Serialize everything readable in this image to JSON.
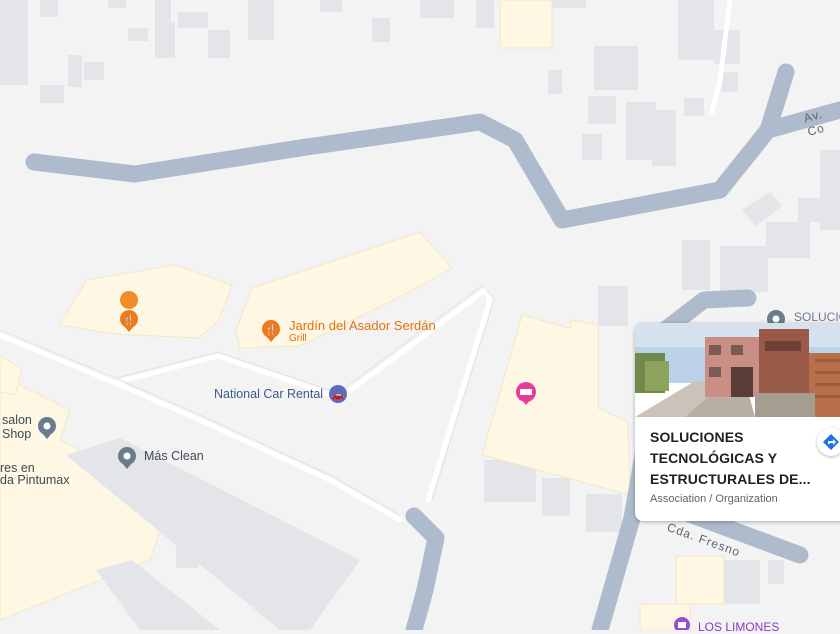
{
  "places": {
    "jardin": {
      "name": "Jardín del Asador Serdán",
      "category": "Grill",
      "icon": "restaurant-icon"
    },
    "unnamed_restaurant": {
      "icon": "restaurant-icon"
    },
    "car_rental": {
      "name": "National Car Rental",
      "icon": "car-rental-icon"
    },
    "mas_clean": {
      "name": "Más Clean",
      "icon": "place-pin-icon"
    },
    "salon": {
      "name_line1": "salon",
      "name_line2": "Shop",
      "icon": "place-pin-icon"
    },
    "talleres": {
      "name_line1": "res en",
      "name_line2": "da Pintumax"
    },
    "hotel": {
      "icon": "hotel-icon"
    },
    "soluciones_marker": {
      "name": "SOLUCIO",
      "icon": "place-pin-icon"
    },
    "los_limones": {
      "name": "LOS LIMONES",
      "icon": "place-pin-icon"
    }
  },
  "roads": {
    "av": "Av. Co",
    "fresno": "Cda. Fresno"
  },
  "info_card": {
    "title": "SOLUCIONES TECNOLÓGICAS Y ESTRUCTURALES DE...",
    "category": "Association / Organization",
    "directions_icon": "directions-icon"
  },
  "colors": {
    "background": "#f3f3f4",
    "building": "#e4e5e8",
    "commercial": "#fdf7e3",
    "main_road": "#aebbcc",
    "poi_orange": "#e8710a",
    "poi_blue": "#3c5a8c",
    "hotel_pink": "#e63c9e"
  }
}
